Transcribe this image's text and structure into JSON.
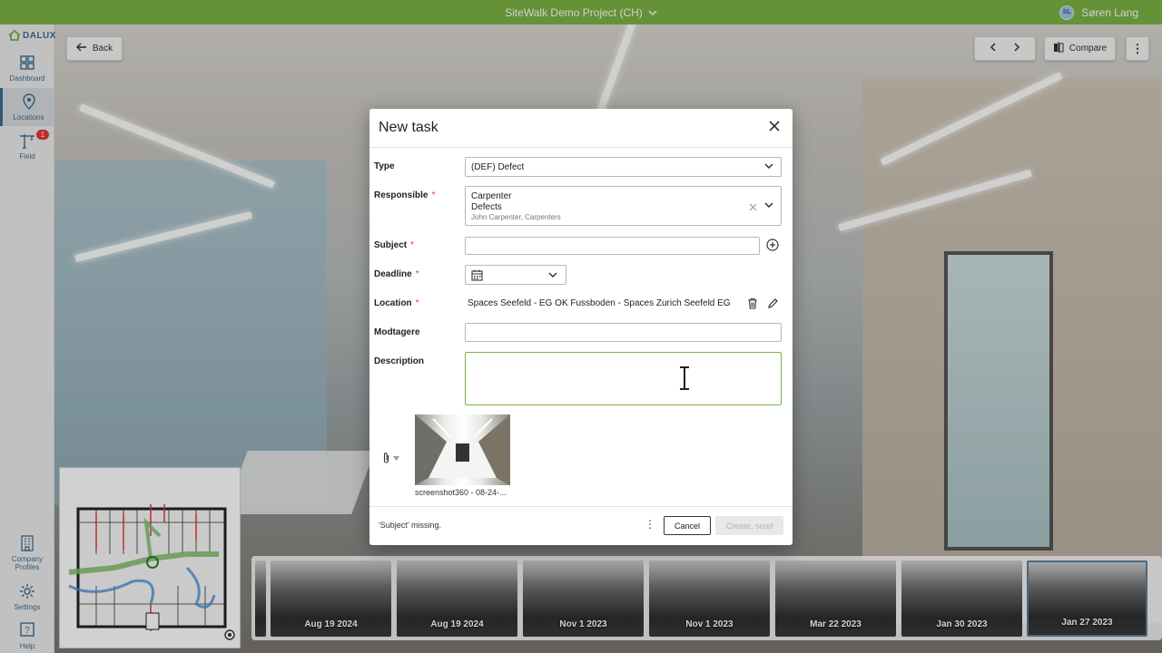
{
  "topbar": {
    "project": "SiteWalk Demo Project (CH)",
    "user_initials": "SL",
    "user_name": "Søren Lang",
    "color": "#7cb342"
  },
  "sidebar": {
    "logo": "DALUX",
    "items": [
      {
        "label": "Dashboard",
        "icon": "dashboard-icon"
      },
      {
        "label": "Locations",
        "icon": "location-pin-icon",
        "active": true
      },
      {
        "label": "Field",
        "icon": "crane-icon",
        "badge": "1"
      },
      {
        "label": "Company\nProfiles",
        "icon": "building-icon"
      },
      {
        "label": "Settings",
        "icon": "gear-icon"
      },
      {
        "label": "Help",
        "icon": "help-icon"
      }
    ]
  },
  "viewer": {
    "back_label": "Back",
    "compare_label": "Compare"
  },
  "timeline": {
    "dates": [
      "Aug 19 2024",
      "Aug 19 2024",
      "Nov 1 2023",
      "Nov 1 2023",
      "Mar 22 2023",
      "Jan 30 2023",
      "Jan 27 2023"
    ],
    "selected": "Jan 27 2023"
  },
  "modal": {
    "title": "New task",
    "fields": {
      "type_label": "Type",
      "type_value": "(DEF) Defect",
      "responsible_label": "Responsible",
      "responsible_line1": "Carpenter",
      "responsible_line2": "Defects",
      "responsible_sub": "John Carpenter, Carpenters",
      "subject_label": "Subject",
      "subject_value": "",
      "deadline_label": "Deadline",
      "location_label": "Location",
      "location_value": "Spaces Seefeld - EG OK Fussboden - Spaces Zurich Seefeld EG",
      "modtagere_label": "Modtagere",
      "description_label": "Description"
    },
    "attachment_name": "screenshot360 - 08-24-...",
    "footer_message": "'Subject' missing.",
    "cancel_label": "Cancel",
    "create_label": "Create, send",
    "required_mark": "*"
  }
}
